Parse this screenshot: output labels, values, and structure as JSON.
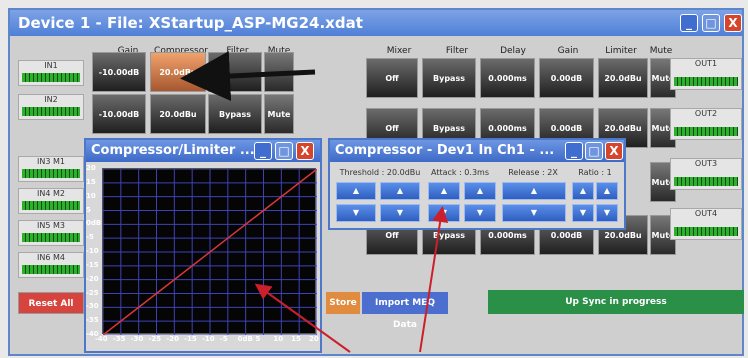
{
  "app": {
    "title": "Device 1  -  File: XStartup_ASP-MG24.xdat"
  },
  "window_controls": {
    "minimize": "_",
    "maximize": "□",
    "close": "X"
  },
  "input_headers": [
    "Gain",
    "Compressor",
    "Filter",
    "Mute"
  ],
  "output_headers": [
    "Mixer",
    "Filter",
    "Delay",
    "Gain",
    "Limiter",
    "Mute"
  ],
  "inputs": [
    {
      "label": "IN1",
      "gain": "-10.00dB",
      "compressor": "20.0dBu",
      "filter": "",
      "mute": ""
    },
    {
      "label": "IN2",
      "gain": "-10.00dB",
      "compressor": "20.0dBu",
      "filter": "Bypass",
      "mute": "Mute"
    },
    {
      "label": "IN3 M1"
    },
    {
      "label": "IN4 M2"
    },
    {
      "label": "IN5 M3"
    },
    {
      "label": "IN6 M4"
    }
  ],
  "outputs": [
    {
      "label": "OUT1",
      "mixer": "Off",
      "filter": "Bypass",
      "delay": "0.000ms",
      "gain": "0.00dB",
      "limiter": "20.0dBu",
      "mute": "Mute"
    },
    {
      "label": "OUT2",
      "mixer": "Off",
      "filter": "Bypass",
      "delay": "0.000ms",
      "gain": "0.00dB",
      "limiter": "20.0dBu",
      "mute": "Mute"
    },
    {
      "label": "OUT3",
      "mixer": "",
      "filter": "",
      "delay": "",
      "gain": "",
      "limiter": "",
      "mute": "Mute"
    },
    {
      "label": "OUT4",
      "mixer": "Off",
      "filter": "Bypass",
      "delay": "0.000ms",
      "gain": "0.00dB",
      "limiter": "20.0dBu",
      "mute": "Mute"
    }
  ],
  "buttons": {
    "reset_all": "Reset All",
    "store": "Store",
    "import_meq": "Import MEQ Data",
    "sync_status": "Up Sync in progress"
  },
  "graph_window": {
    "title": "Compressor/Limiter ...",
    "yticks": [
      "20",
      "15",
      "10",
      "5",
      "0dB",
      "-5",
      "-10",
      "-15",
      "-20",
      "-25",
      "-30",
      "-35",
      "-40"
    ],
    "xticks": [
      "-40",
      "-35",
      "-30",
      "-25",
      "-20",
      "-15",
      "-10",
      "-5",
      "0dB",
      "5",
      "10",
      "15",
      "20"
    ],
    "colors": {
      "grid": "#3d43b7",
      "curve": "#d73737"
    }
  },
  "compressor_window": {
    "title": "Compressor - Dev1 In Ch1  - ...",
    "threshold": "Threshold : 20.0dBu",
    "attack": "Attack : 0.3ms",
    "release": "Release : 2X",
    "ratio": "Ratio : 1"
  },
  "annotation_colors": {
    "arrow": "#111111",
    "callout": "#cc1f2c"
  }
}
